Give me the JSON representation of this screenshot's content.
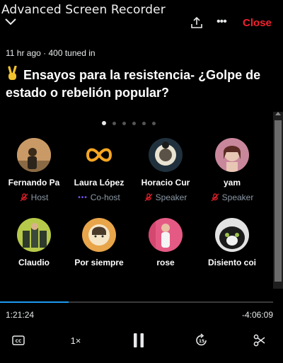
{
  "window": {
    "title": "Advanced Screen Recorder"
  },
  "header": {
    "close_label": "Close",
    "icons": [
      "chevron-down-icon",
      "share-icon",
      "more-icon"
    ]
  },
  "space": {
    "meta": "11 hr ago · 400 tuned in",
    "title": "Ensayos para la resistencia- ¿Golpe de estado o rebelión popular?",
    "page_count": 6,
    "active_page": 1
  },
  "participants": [
    {
      "name": "Fernando Pa",
      "role": "Host",
      "role_icon": "microphone-off-icon"
    },
    {
      "name": "Laura López",
      "role": "Co-host",
      "role_icon": "dots-icon"
    },
    {
      "name": "Horacio Cur",
      "role": "Speaker",
      "role_icon": "microphone-off-icon"
    },
    {
      "name": "yam",
      "role": "Speaker",
      "role_icon": "microphone-off-icon"
    },
    {
      "name": "Claudio",
      "role": ""
    },
    {
      "name": "Por siempre",
      "role": ""
    },
    {
      "name": "rose",
      "role": ""
    },
    {
      "name": "Disiento coi",
      "role": ""
    }
  ],
  "player": {
    "elapsed": "1:21:24",
    "remaining": "-4:06:09",
    "progress_fraction": 0.25,
    "speed": "1×",
    "skip_seconds": "15",
    "icons": [
      "captions-icon",
      "pause-icon",
      "skip-forward-icon",
      "scissors-icon"
    ]
  },
  "colors": {
    "accent": "#1d9bf0",
    "close": "#f4212e",
    "muted": "#8b98a5",
    "role_red": "#f4212e"
  }
}
